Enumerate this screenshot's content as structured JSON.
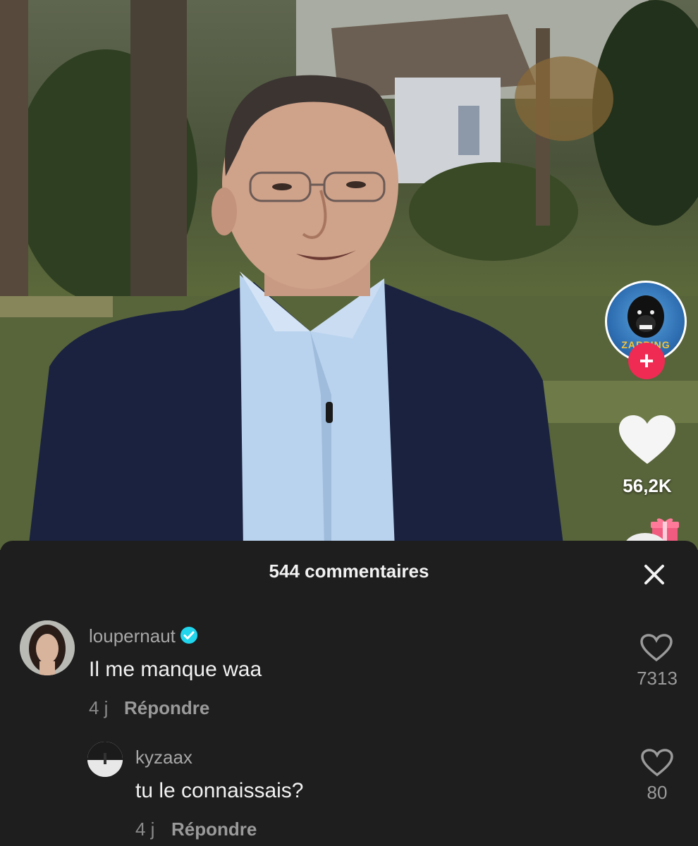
{
  "video": {
    "creator_avatar_text": "ZAPPING",
    "follow_symbol": "+",
    "like_count": "56,2K",
    "icons": [
      "heart-icon",
      "gift-icon",
      "plus-icon"
    ]
  },
  "comments_panel": {
    "title": "544 commentaires",
    "close_icon": "close-icon",
    "comments": [
      {
        "username": "loupernaut",
        "verified": true,
        "text": "Il me manque waa",
        "age": "4 j",
        "reply_label": "Répondre",
        "likes": "7313"
      },
      {
        "username": "kyzaax",
        "verified": false,
        "text": "tu le connaissais?",
        "age": "4 j",
        "reply_label": "Répondre",
        "likes": "80"
      }
    ]
  },
  "colors": {
    "sheet_background": "#1e1e1e",
    "follow_accent": "#ef2b54",
    "verified_badge": "#20d5ec"
  }
}
